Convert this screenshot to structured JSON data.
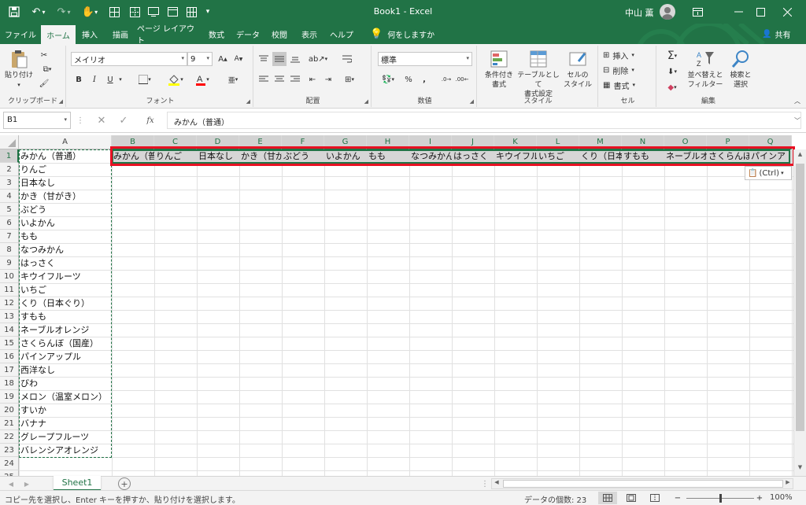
{
  "title": "Book1  -  Excel",
  "user": {
    "name": "中山 薫"
  },
  "tabs": [
    "ファイル",
    "ホーム",
    "挿入",
    "描画",
    "ページ レイアウト",
    "数式",
    "データ",
    "校閲",
    "表示",
    "ヘルプ"
  ],
  "active_tab": "ホーム",
  "tell_me": "何をしますか",
  "share": "共有",
  "ribbon": {
    "clipboard": {
      "label": "クリップボード",
      "paste": "貼り付け"
    },
    "font": {
      "label": "フォント",
      "name": "メイリオ",
      "size": "9",
      "bold": "B",
      "italic": "I",
      "underline": "U"
    },
    "alignment": {
      "label": "配置"
    },
    "number": {
      "label": "数値",
      "format": "標準",
      "percent": "%",
      "comma": ","
    },
    "styles": {
      "label": "スタイル",
      "conditional": "条件付き\n書式",
      "table": "テーブルとして\n書式設定",
      "cell": "セルの\nスタイル"
    },
    "cells": {
      "label": "セル",
      "insert": "挿入",
      "delete": "削除",
      "format": "書式"
    },
    "editing": {
      "label": "編集",
      "sort": "並べ替えと\nフィルター",
      "find": "検索と\n選択"
    }
  },
  "name_box": "B1",
  "formula": "みかん（普通）",
  "columns": [
    "A",
    "B",
    "C",
    "D",
    "E",
    "F",
    "G",
    "H",
    "I",
    "J",
    "K",
    "L",
    "M",
    "N",
    "O",
    "P",
    "Q"
  ],
  "row_numbers": [
    "1",
    "2",
    "3",
    "4",
    "5",
    "6",
    "7",
    "8",
    "9",
    "10",
    "11",
    "12",
    "13",
    "14",
    "15",
    "16",
    "17",
    "18",
    "19",
    "20",
    "21",
    "22",
    "23",
    "24",
    "25"
  ],
  "col_a": [
    "みかん（普通）",
    "りんご",
    "日本なし",
    "かき（甘がき）",
    "ぶどう",
    "いよかん",
    "もも",
    "なつみかん",
    "はっさく",
    "キウイフルーツ",
    "いちご",
    "くり（日本ぐり）",
    "すもも",
    "ネーブルオレンジ",
    "さくらんぼ（国産）",
    "パインアップル",
    "西洋なし",
    "びわ",
    "メロン（温室メロン）",
    "すいか",
    "バナナ",
    "グレープフルーツ",
    "バレンシアオレンジ"
  ],
  "row1": [
    "みかん（普",
    "りんご",
    "日本なし",
    "かき（甘が",
    "ぶどう",
    "いよかん",
    "もも",
    "なつみかん",
    "はっさく",
    "キウイフル",
    "いちご",
    "くり（日本",
    "すもも",
    "ネーブルオ",
    "さくらんぼ",
    "パインア"
  ],
  "paste_options": "(Ctrl)",
  "sheet_tab": "Sheet1",
  "status": {
    "message": "コピー先を選択し、Enter キーを押すか、貼り付けを選択します。",
    "count": "データの個数: 23",
    "zoom": "100%"
  },
  "colors": {
    "brand": "#217346",
    "highlight": "#e81123",
    "selection": "#217346"
  }
}
